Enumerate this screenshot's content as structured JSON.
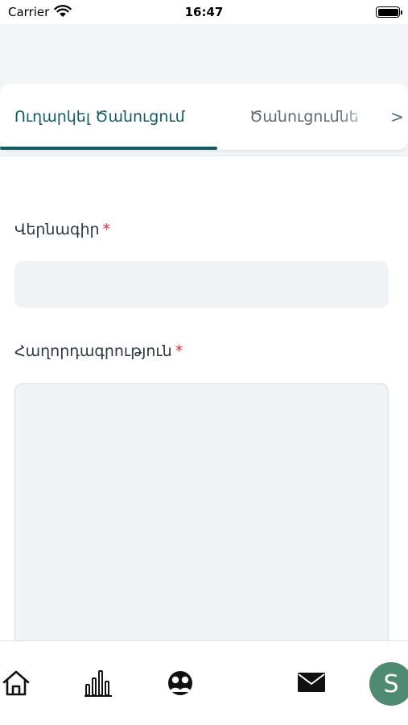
{
  "status_bar": {
    "carrier": "Carrier",
    "time": "16:47"
  },
  "tabs": [
    {
      "label": "Ուղարկել Ծանուցում",
      "active": true
    },
    {
      "label": "Ծանուցումնե",
      "active": false
    }
  ],
  "tabs_next": ">",
  "form": {
    "title_label": "Վերնագիր",
    "title_value": "",
    "message_label": "Հաղորդագրություն",
    "message_value": "",
    "required_mark": "*"
  },
  "bottom_nav": {
    "items": [
      {
        "icon": "home-icon"
      },
      {
        "icon": "stats-icon"
      },
      {
        "icon": "community-icon"
      },
      {
        "icon": "mail-icon"
      }
    ],
    "avatar_initial": "S"
  },
  "colors": {
    "accent": "#135a63",
    "required": "#e0323c",
    "avatar_bg": "#4f8b73",
    "input_bg": "#f0f3f6",
    "header_bg": "#f3f6f8"
  }
}
